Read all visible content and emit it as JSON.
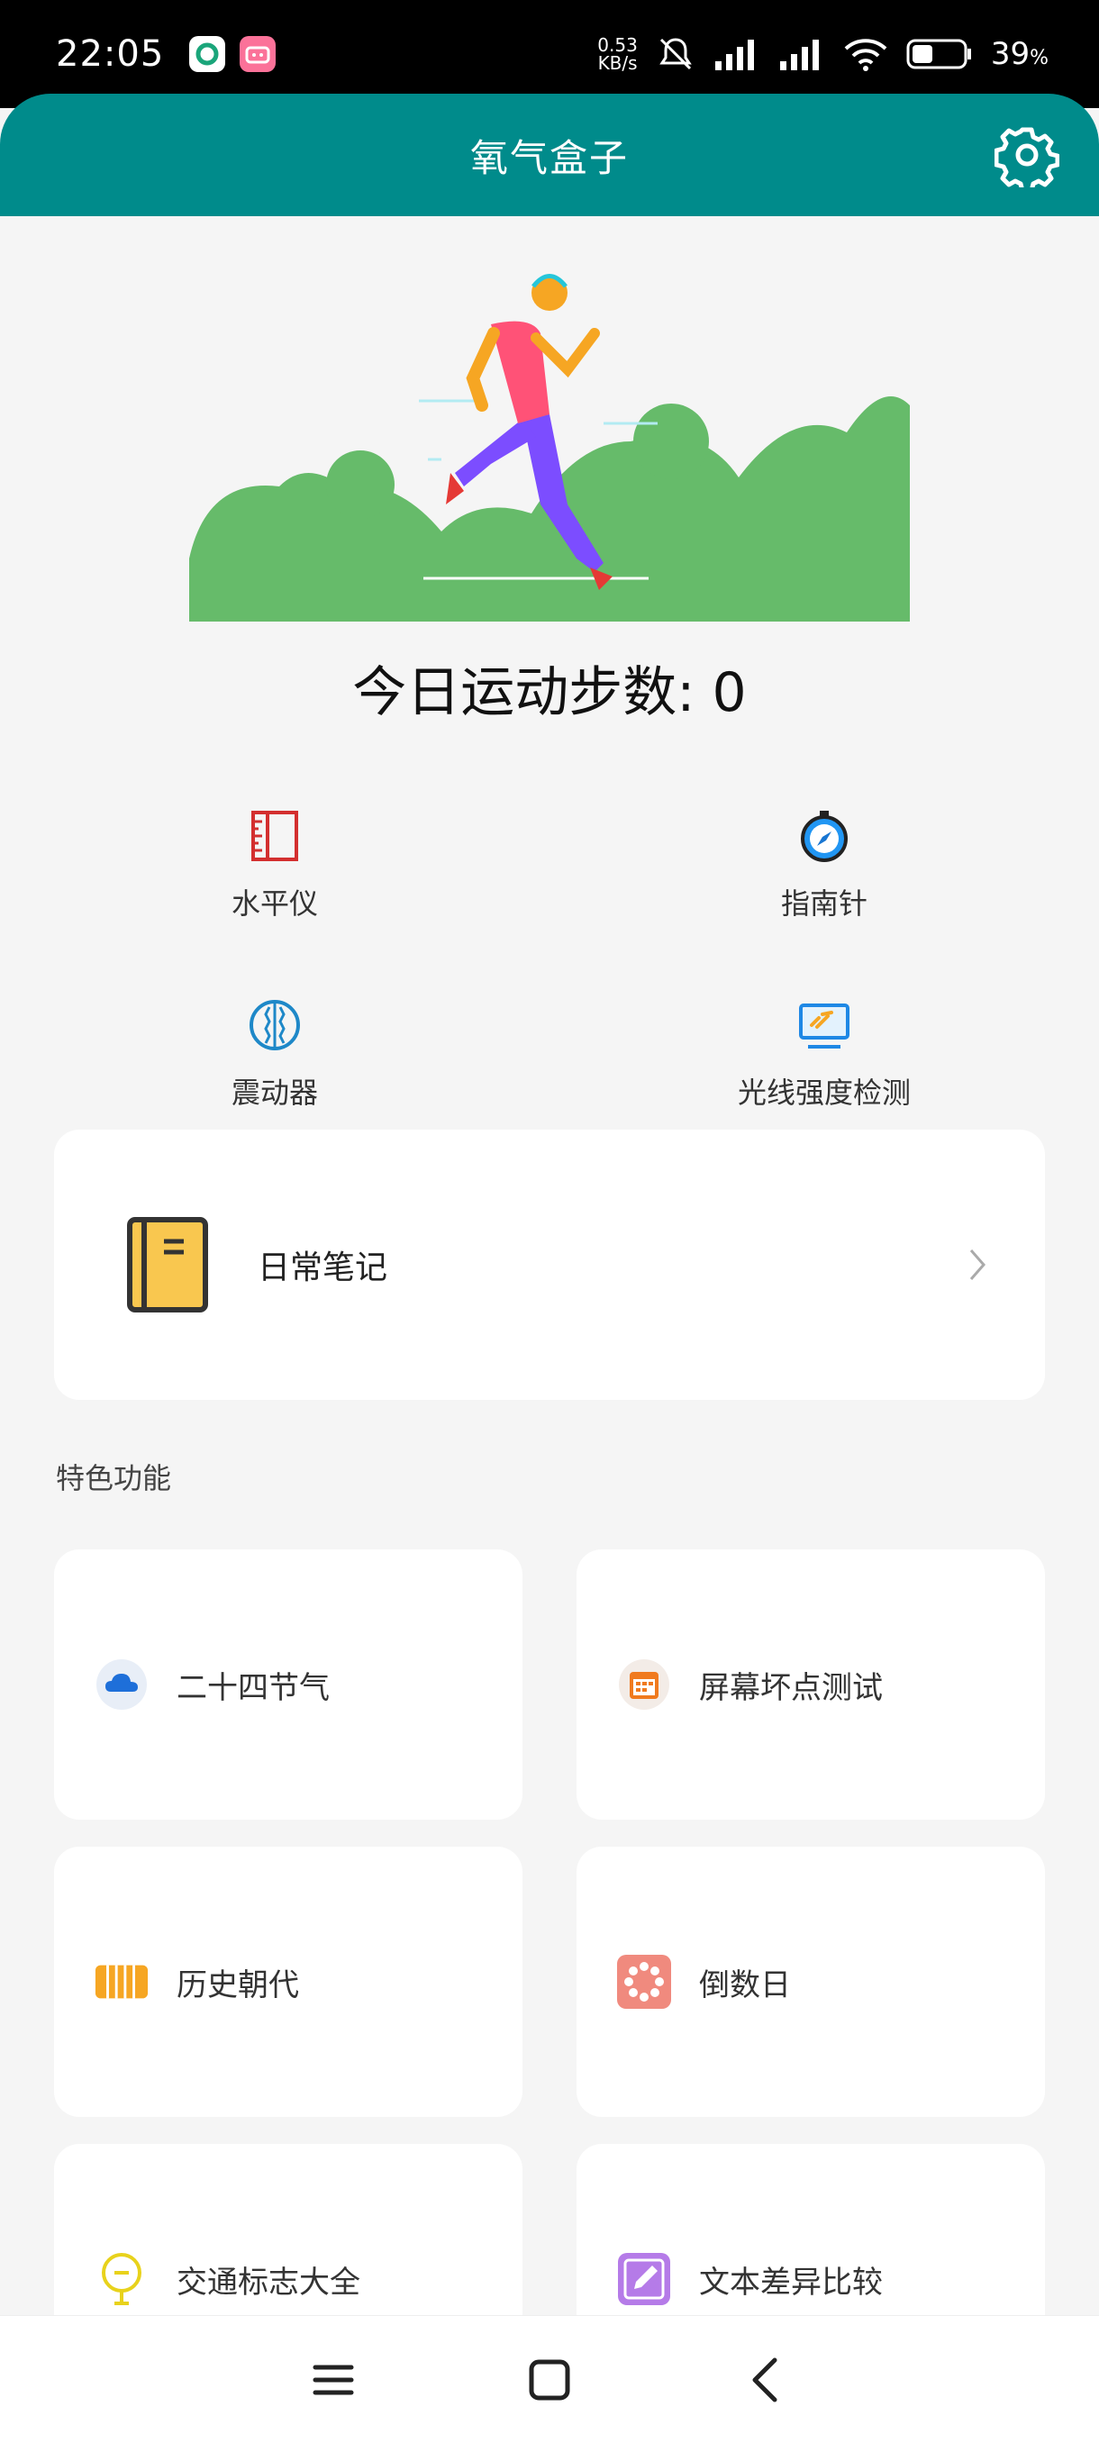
{
  "status_bar": {
    "time": "22:05",
    "net_speed_value": "0.53",
    "net_speed_unit": "KB/s",
    "battery_percent": "39",
    "battery_unit": "%"
  },
  "app_bar": {
    "title": "氧气盒子"
  },
  "steps": {
    "label": "今日运动步数: 0"
  },
  "tools": [
    {
      "label": "水平仪",
      "icon": "level-ruler-icon"
    },
    {
      "label": "指南针",
      "icon": "compass-icon"
    },
    {
      "label": "震动器",
      "icon": "vibrator-icon"
    },
    {
      "label": "光线强度检测",
      "icon": "light-meter-icon"
    }
  ],
  "notes": {
    "label": "日常笔记",
    "icon": "notebook-icon"
  },
  "features_section": {
    "title": "特色功能"
  },
  "features": [
    {
      "label": "二十四节气",
      "icon": "cloud-icon",
      "color": "#1e6fd9"
    },
    {
      "label": "屏幕坏点测试",
      "icon": "calendar-icon",
      "color": "#f07a1e"
    },
    {
      "label": "历史朝代",
      "icon": "scroll-icon",
      "color": "#f6a623"
    },
    {
      "label": "倒数日",
      "icon": "ring-icon",
      "color": "#f08a7e"
    },
    {
      "label": "交通标志大全",
      "icon": "traffic-sign-icon",
      "color": "#e8d21c"
    },
    {
      "label": "文本差异比较",
      "icon": "edit-icon",
      "color": "#b57be8"
    }
  ],
  "colors": {
    "primary": "#008b8b",
    "hero_green": "#66bb6a",
    "background": "#f5f5f5"
  }
}
